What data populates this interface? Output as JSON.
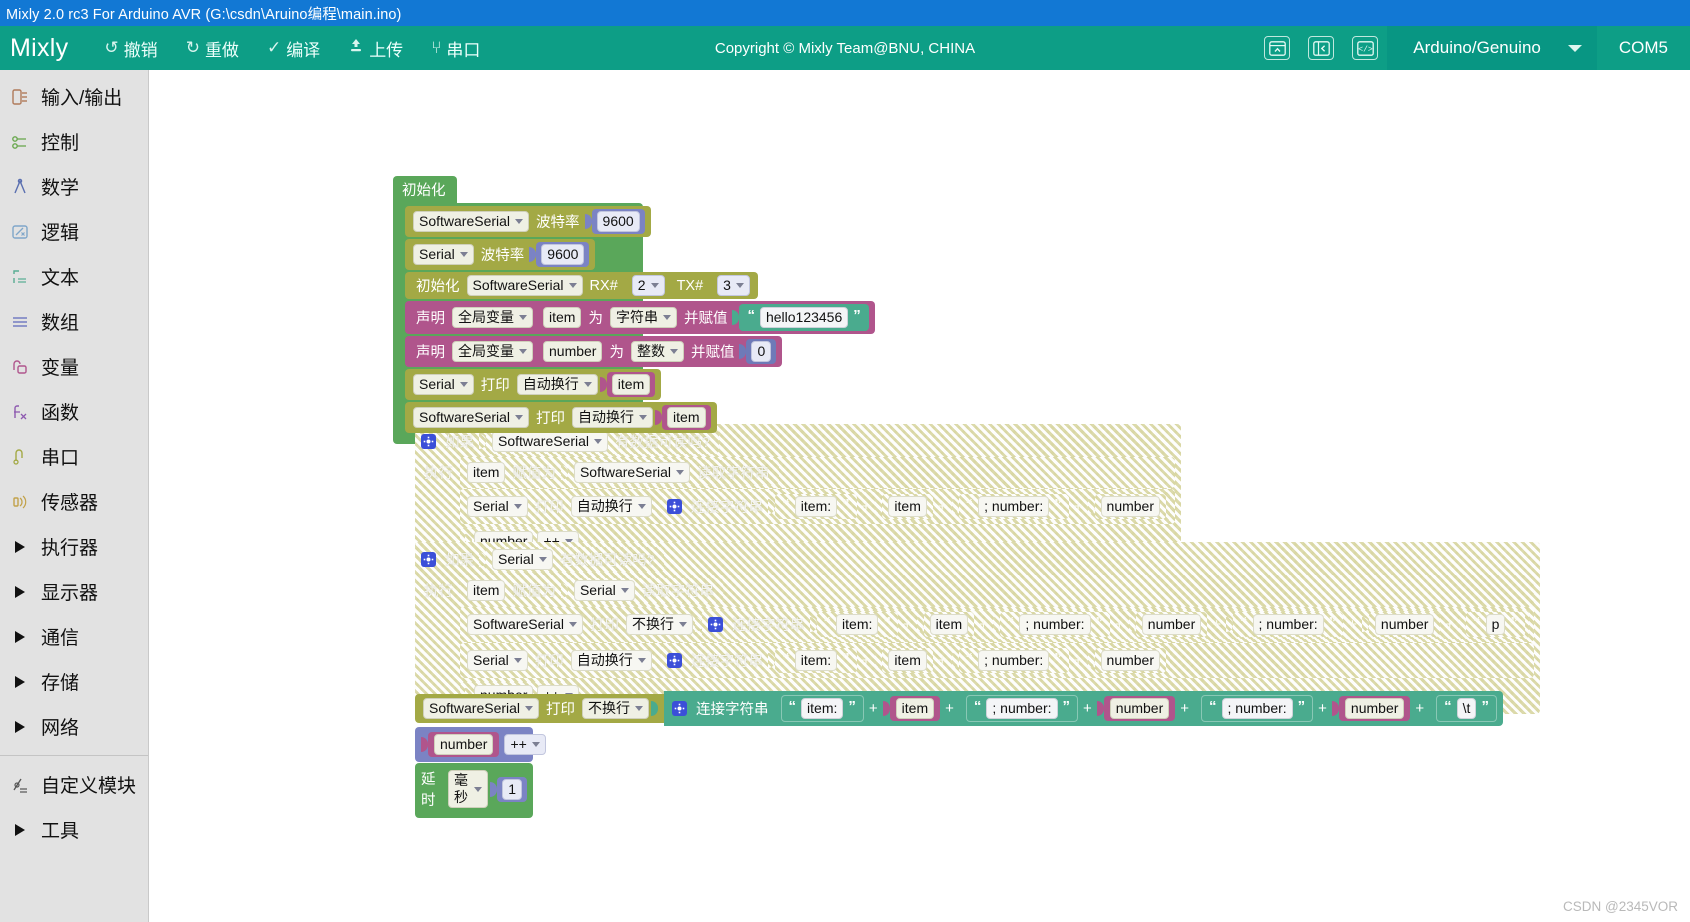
{
  "window": {
    "title": "Mixly 2.0 rc3 For Arduino AVR (G:\\csdn\\Aruino编程\\main.ino)"
  },
  "toolbar": {
    "brand": "Mixly",
    "copyright": "Copyright © Mixly Team@BNU, CHINA",
    "buttons": [
      {
        "name": "undo",
        "icon": "undo-icon",
        "glyph": "↺",
        "label": "撤销"
      },
      {
        "name": "redo",
        "icon": "redo-icon",
        "glyph": "↻",
        "label": "重做"
      },
      {
        "name": "compile",
        "icon": "check-icon",
        "glyph": "✓",
        "label": "编译"
      },
      {
        "name": "upload",
        "icon": "upload-icon",
        "glyph": "⬆",
        "label": "上传"
      },
      {
        "name": "serial-monitor",
        "icon": "usb-icon",
        "glyph": "⑂",
        "label": "串口"
      }
    ],
    "icon_buttons": [
      {
        "name": "toggle-bottom-panel",
        "icon": "panel-collapse-icon"
      },
      {
        "name": "toggle-side-panel",
        "icon": "sidebar-toggle-icon"
      },
      {
        "name": "view-code",
        "icon": "code-icon"
      }
    ],
    "board": "Arduino/Genuino",
    "port": "COM5"
  },
  "sidebar": {
    "items": [
      {
        "label": "输入/输出",
        "icon": "io-icon",
        "color": "#b07a5a",
        "arrow": false
      },
      {
        "label": "控制",
        "icon": "control-icon",
        "color": "#6aa84f",
        "arrow": false
      },
      {
        "label": "数学",
        "icon": "math-icon",
        "color": "#5a6fb0",
        "arrow": false
      },
      {
        "label": "逻辑",
        "icon": "logic-icon",
        "color": "#7fa6c9",
        "arrow": false
      },
      {
        "label": "文本",
        "icon": "text-icon",
        "color": "#58ad93",
        "arrow": false
      },
      {
        "label": "数组",
        "icon": "array-icon",
        "color": "#7b83c4",
        "arrow": false
      },
      {
        "label": "变量",
        "icon": "variable-icon",
        "color": "#b0558c",
        "arrow": false
      },
      {
        "label": "函数",
        "icon": "function-icon",
        "color": "#8e5ab0",
        "arrow": false
      },
      {
        "label": "串口",
        "icon": "serial-icon",
        "color": "#a3a945",
        "arrow": false
      },
      {
        "label": "传感器",
        "icon": "sensor-icon",
        "color": "#c2a24a",
        "arrow": false
      },
      {
        "label": "执行器",
        "icon": "actuator-icon",
        "color": "#111111",
        "arrow": true
      },
      {
        "label": "显示器",
        "icon": "display-icon",
        "color": "#111111",
        "arrow": true
      },
      {
        "label": "通信",
        "icon": "communication-icon",
        "color": "#111111",
        "arrow": true
      },
      {
        "label": "存储",
        "icon": "storage-icon",
        "color": "#111111",
        "arrow": true
      },
      {
        "label": "网络",
        "icon": "network-icon",
        "color": "#111111",
        "arrow": true
      }
    ],
    "bottom_items": [
      {
        "label": "自定义模块",
        "icon": "custom-module-icon",
        "arrow": false
      },
      {
        "label": "工具",
        "icon": "tools-icon",
        "arrow": true
      }
    ]
  },
  "blocks": {
    "setup": {
      "hat": "初始化",
      "r1": {
        "device": "SoftwareSerial",
        "label": "波特率",
        "value": "9600"
      },
      "r2": {
        "device": "Serial",
        "label": "波特率",
        "value": "9600"
      },
      "r3": {
        "label": "初始化",
        "device": "SoftwareSerial",
        "rx_label": "RX#",
        "rx": "2",
        "tx_label": "TX#",
        "tx": "3"
      },
      "r4": {
        "declare": "声明",
        "scope": "全局变量",
        "name": "item",
        "as": "为",
        "type": "字符串",
        "assign": "并赋值",
        "value": "hello123456"
      },
      "r5": {
        "declare": "声明",
        "scope": "全局变量",
        "name": "number",
        "as": "为",
        "type": "整数",
        "assign": "并赋值",
        "value": "0"
      },
      "r6": {
        "device": "Serial",
        "print": "打印",
        "mode": "自动换行",
        "value": "item"
      },
      "r7": {
        "device": "SoftwareSerial",
        "print": "打印",
        "mode": "自动换行",
        "value": "item"
      }
    },
    "if1": {
      "if_label": "如果",
      "device": "SoftwareSerial",
      "cond": "有数据可读吗?",
      "do_label": "执行",
      "assign_var": "item",
      "assign_label": "赋值为",
      "assign_device": "SoftwareSerial",
      "assign_op": "读取字符串",
      "print_device": "Serial",
      "print_label": "打印",
      "print_mode": "自动换行",
      "join_label": "连接字符串",
      "join_parts": [
        "item:",
        "item",
        "; number:",
        "number"
      ],
      "inc_var": "number",
      "inc_op": "++"
    },
    "if2": {
      "if_label": "如果",
      "device": "Serial",
      "cond": "有数据可读吗?",
      "do_label": "执行",
      "assign_var": "item",
      "assign_label": "赋值为",
      "assign_device": "Serial",
      "assign_op": "读取字符串",
      "print1_device": "SoftwareSerial",
      "print1_label": "打印",
      "print1_mode": "不换行",
      "join1_label": "连接字符串",
      "join1_parts": [
        "item:",
        "item",
        "; number:",
        "number",
        "; number:",
        "number",
        "p"
      ],
      "print2_device": "Serial",
      "print2_label": "打印",
      "print2_mode": "自动换行",
      "join2_label": "连接字符串",
      "join2_parts": [
        "item:",
        "item",
        "; number:",
        "number"
      ],
      "inc_var": "number",
      "inc_op": "++"
    },
    "tail": {
      "print_device": "SoftwareSerial",
      "print_label": "打印",
      "print_mode": "不换行",
      "join_label": "连接字符串",
      "join_parts": [
        "item:",
        "item",
        "; number:",
        "number",
        "; number:",
        "number",
        "\\t"
      ],
      "inc_var": "number",
      "inc_op": "++",
      "delay_label": "延时",
      "delay_unit": "毫秒",
      "delay_value": "1"
    }
  },
  "watermark": "CSDN @2345VOR"
}
